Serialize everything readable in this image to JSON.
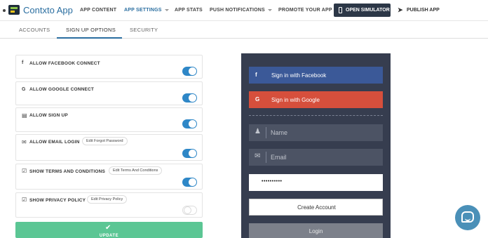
{
  "app": {
    "name": "Contxto App"
  },
  "nav": {
    "items": [
      {
        "label": "APP CONTENT"
      },
      {
        "label": "APP SETTINGS",
        "active": true,
        "dropdown": true
      },
      {
        "label": "APP STATS"
      },
      {
        "label": "PUSH NOTIFICATIONS",
        "dropdown": true
      },
      {
        "label": "PROMOTE YOUR APP"
      }
    ],
    "open_simulator": "OPEN SIMULATOR",
    "publish": "PUBLISH APP"
  },
  "subtabs": [
    {
      "label": "ACCOUNTS"
    },
    {
      "label": "SIGN UP OPTIONS",
      "active": true
    },
    {
      "label": "SECURITY"
    }
  ],
  "settings": [
    {
      "icon": "facebook-icon",
      "label": "ALLOW FACEBOOK CONNECT",
      "enabled": true
    },
    {
      "icon": "google-icon",
      "label": "ALLOW GOOGLE CONNECT",
      "enabled": true
    },
    {
      "icon": "id-card-icon",
      "label": "ALLOW SIGN UP",
      "enabled": true
    },
    {
      "icon": "envelope-icon",
      "label": "ALLOW EMAIL LOGIN",
      "link": "Edit Forgot Password",
      "enabled": true
    },
    {
      "icon": "checkbox-icon",
      "label": "SHOW TERMS AND CONDITIONS",
      "link": "Edit Terms And Conditions",
      "enabled": true
    },
    {
      "icon": "checkbox-icon",
      "label": "SHOW PRIVACY POLICY",
      "link": "Edit Privacy Policy",
      "enabled": false
    }
  ],
  "update_button": {
    "label": "UPDATE"
  },
  "simulator": {
    "facebook_button": "Sign in with Facebook",
    "google_button": "Sign in with Google",
    "name_placeholder": "Name",
    "email_placeholder": "Email",
    "password_value": "••••••••••",
    "create_account": "Create Account",
    "login": "Login"
  },
  "colors": {
    "accent": "#2a6ea0",
    "toggle_on": "#2e87c7",
    "update": "#5bc694",
    "simulator_bg": "#363d4f",
    "facebook": "#3b5998",
    "google": "#d64f3c"
  }
}
